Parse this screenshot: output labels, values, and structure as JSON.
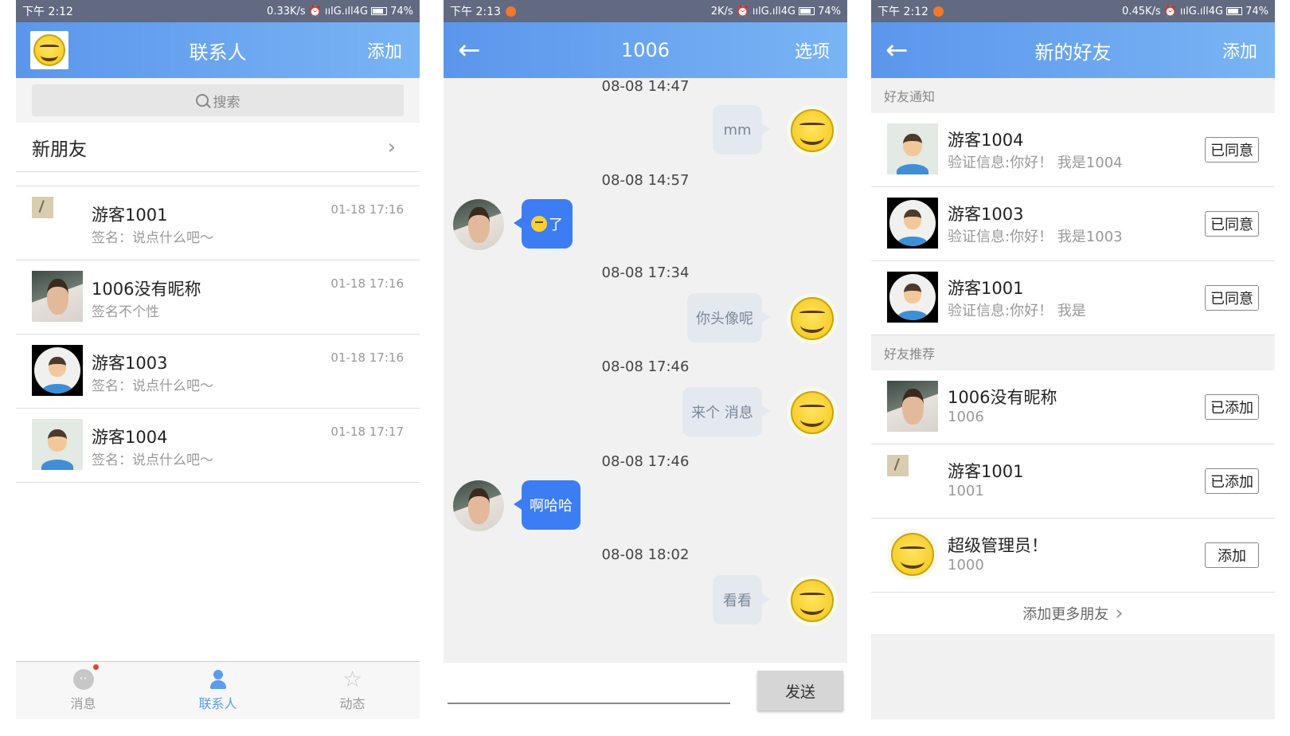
{
  "status_bars": [
    {
      "time": "下午 2:12",
      "speed": "0.33K/s",
      "signal": "ıılG.ıll4G",
      "battery": "74%",
      "notif": false
    },
    {
      "time": "下午 2:13",
      "speed": "2K/s",
      "signal": "ıılG.ıll4G",
      "battery": "74%",
      "notif": true
    },
    {
      "time": "下午 2:12",
      "speed": "0.45K/s",
      "signal": "ıılG.ıll4G",
      "battery": "74%",
      "notif": true
    }
  ],
  "contacts_screen": {
    "title": "联系人",
    "add_label": "添加",
    "search_placeholder": "搜索",
    "new_friend_label": "新朋友",
    "contacts": [
      {
        "name": "游客1001",
        "signature": "签名：说点什么吧～",
        "time": "01-18 17:16",
        "avatar": "small"
      },
      {
        "name": "1006没有昵称",
        "signature": "签名不个性",
        "time": "01-18 17:16",
        "avatar": "photo"
      },
      {
        "name": "游客1003",
        "signature": "签名：说点什么吧～",
        "time": "01-18 17:16",
        "avatar": "cartoon"
      },
      {
        "name": "游客1004",
        "signature": "签名：说点什么吧～",
        "time": "01-18 17:17",
        "avatar": "light"
      }
    ],
    "tabs": [
      {
        "label": "消息",
        "icon": "message-icon",
        "active": false,
        "badge": true
      },
      {
        "label": "联系人",
        "icon": "contacts-icon",
        "active": true,
        "badge": false
      },
      {
        "label": "动态",
        "icon": "star-icon",
        "active": false,
        "badge": false
      }
    ]
  },
  "chat_screen": {
    "title": "1006",
    "options_label": "选项",
    "messages": [
      {
        "timestamp": "08-08 14:47",
        "direction": "out",
        "text": "mm"
      },
      {
        "timestamp": "08-08 14:57",
        "direction": "in",
        "text": "了",
        "emoji": true
      },
      {
        "timestamp": "08-08 17:34",
        "direction": "out",
        "text": "你头像呢"
      },
      {
        "timestamp": "08-08 17:46",
        "direction": "out",
        "text": "来个 消息"
      },
      {
        "timestamp": "08-08 17:46",
        "direction": "in",
        "text": "啊哈哈"
      },
      {
        "timestamp": "08-08 18:02",
        "direction": "out",
        "text": "看看"
      }
    ],
    "send_label": "发送"
  },
  "new_friends_screen": {
    "title": "新的好友",
    "add_label": "添加",
    "notifications_header": "好友通知",
    "requests": [
      {
        "name": "游客1004",
        "message": "验证信息:你好！ 我是1004",
        "button": "已同意",
        "avatar": "light"
      },
      {
        "name": "游客1003",
        "message": "验证信息:你好！ 我是1003",
        "button": "已同意",
        "avatar": "cartoon"
      },
      {
        "name": "游客1001",
        "message": "验证信息:你好！ 我是",
        "button": "已同意",
        "avatar": "cartoon"
      }
    ],
    "recommend_header": "好友推荐",
    "recommendations": [
      {
        "name": "1006没有昵称",
        "id": "1006",
        "button": "已添加",
        "avatar": "photo"
      },
      {
        "name": "游客1001",
        "id": "1001",
        "button": "已添加",
        "avatar": "small"
      },
      {
        "name": "超级管理员！",
        "id": "1000",
        "button": "添加",
        "avatar": "smiley"
      }
    ],
    "more_label": "添加更多朋友"
  }
}
